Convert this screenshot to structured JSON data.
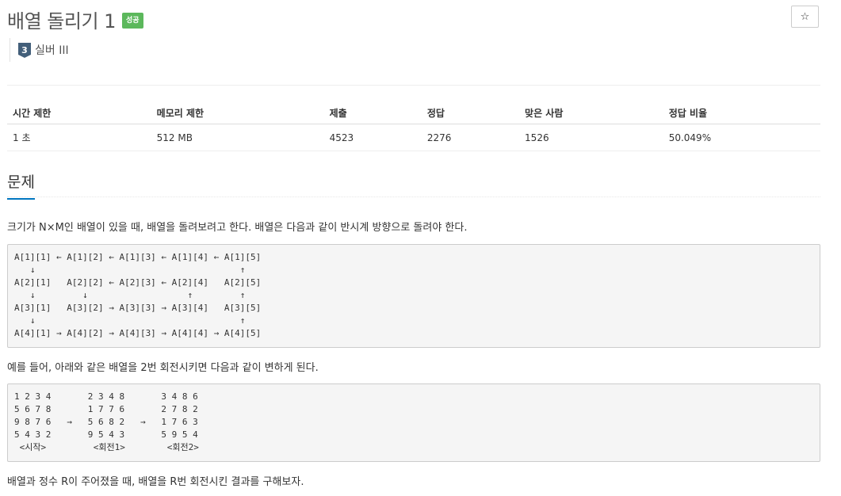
{
  "problem": {
    "title": "배열 돌리기 1",
    "badge": "성공",
    "star_icon": "☆",
    "tier_number": "3",
    "tier_label": "실버 III",
    "tier_color": "#435f7a"
  },
  "stats": {
    "headers": [
      "시간 제한",
      "메모리 제한",
      "제출",
      "정답",
      "맞은 사람",
      "정답 비율"
    ],
    "values": [
      "1 초",
      "512 MB",
      "4523",
      "2276",
      "1526",
      "50.049%"
    ]
  },
  "section": {
    "heading": "문제",
    "para1": "크기가 N×M인 배열이 있을 때, 배열을 돌려보려고 한다. 배열은 다음과 같이 반시계 방향으로 돌려야 한다.",
    "pre1": "A[1][1] ← A[1][2] ← A[1][3] ← A[1][4] ← A[1][5]\n   ↓                                       ↑\nA[2][1]   A[2][2] ← A[2][3] ← A[2][4]   A[2][5]\n   ↓         ↓                   ↑         ↑\nA[3][1]   A[3][2] → A[3][3] → A[3][4]   A[3][5]\n   ↓                                       ↑\nA[4][1] → A[4][2] → A[4][3] → A[4][4] → A[4][5]",
    "para2": "예를 들어, 아래와 같은 배열을 2번 회전시키면 다음과 같이 변하게 된다.",
    "pre2": "1 2 3 4       2 3 4 8       3 4 8 6\n5 6 7 8       1 7 7 6       2 7 8 2\n9 8 7 6   →   5 6 8 2   →   1 7 6 3\n5 4 3 2       9 5 4 3       5 9 5 4\n <시작>         <회전1>        <회전2>",
    "para3": "배열과 정수 R이 주어졌을 때, 배열을 R번 회전시킨 결과를 구해보자."
  },
  "colors": {
    "badge_green": "#5cb85c",
    "accent_blue": "#0076c0"
  }
}
